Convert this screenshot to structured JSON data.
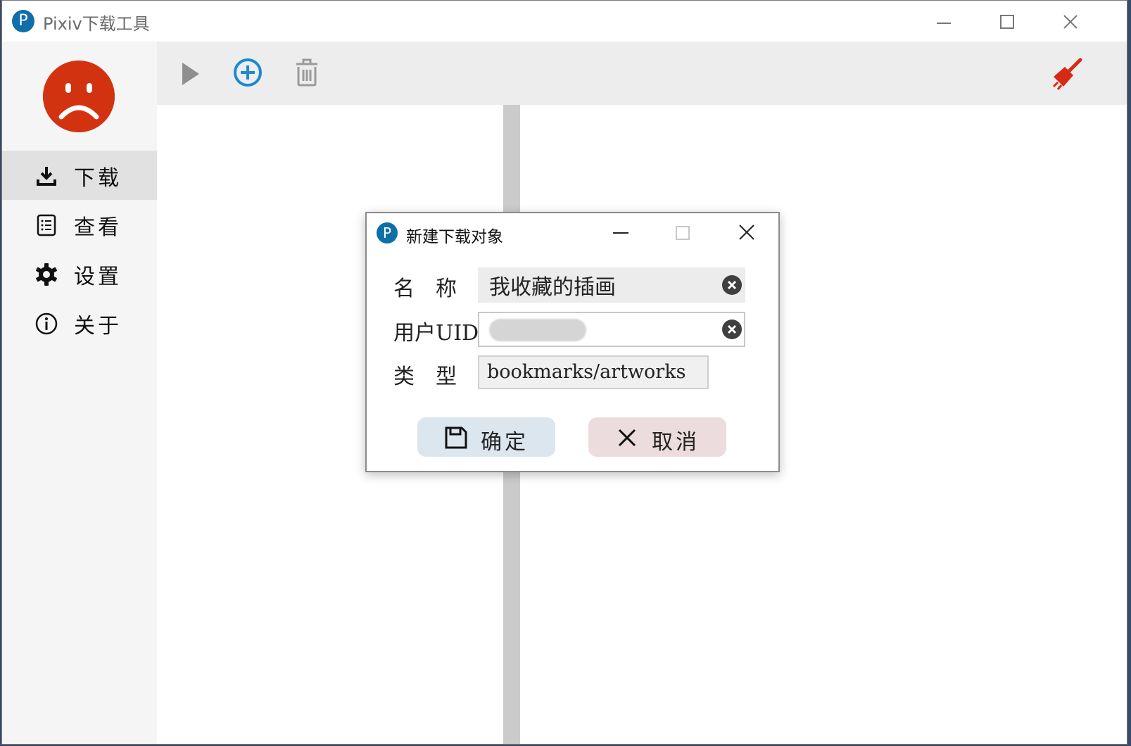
{
  "window": {
    "title": "Pixiv下载工具",
    "logo_letter": "P"
  },
  "sidebar": {
    "items": [
      {
        "label": "下载",
        "icon": "download-icon",
        "active": true
      },
      {
        "label": "查看",
        "icon": "list-icon",
        "active": false
      },
      {
        "label": "设置",
        "icon": "gear-icon",
        "active": false
      },
      {
        "label": "关于",
        "icon": "info-icon",
        "active": false
      }
    ],
    "avatar_color": "#d33211"
  },
  "toolbar": {
    "buttons": [
      "play-icon",
      "add-circle-icon",
      "trash-icon",
      "broom-icon"
    ],
    "accent": "#1a8ad0",
    "broom_color": "#d62a16"
  },
  "dialog": {
    "title": "新建下载对象",
    "logo_letter": "P",
    "name_label": "名　称",
    "name_value": "我收藏的插画",
    "uid_label": "用户UID",
    "uid_value": "",
    "type_label": "类　型",
    "type_value": "bookmarks/artworks",
    "ok_label": "确定",
    "cancel_label": "取消",
    "ok_bg": "#dce6ef",
    "cancel_bg": "#eddcdd"
  }
}
